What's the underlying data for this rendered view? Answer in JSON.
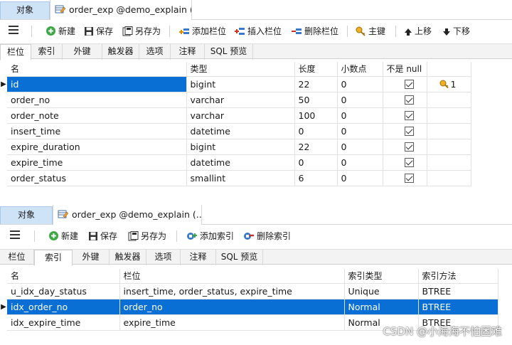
{
  "top": {
    "object_tab": "对象",
    "doc_tab": "order_exp @demo_explain (...",
    "toolbar": {
      "new": "新建",
      "save": "保存",
      "save_as": "另存为",
      "add_column": "添加栏位",
      "insert_column": "插入栏位",
      "delete_column": "删除栏位",
      "primary_key": "主键",
      "move_up": "上移",
      "move_down": "下移"
    },
    "subtabs": [
      "栏位",
      "索引",
      "外键",
      "触发器",
      "选项",
      "注释",
      "SQL 预览"
    ],
    "active_subtab": "栏位",
    "columns_header": [
      "名",
      "类型",
      "长度",
      "小数点",
      "不是 null",
      ""
    ],
    "rows": [
      {
        "name": "id",
        "type": "bigint",
        "length": "22",
        "decimals": "0",
        "not_null": true,
        "key": "1"
      },
      {
        "name": "order_no",
        "type": "varchar",
        "length": "50",
        "decimals": "0",
        "not_null": true,
        "key": ""
      },
      {
        "name": "order_note",
        "type": "varchar",
        "length": "100",
        "decimals": "0",
        "not_null": true,
        "key": ""
      },
      {
        "name": "insert_time",
        "type": "datetime",
        "length": "0",
        "decimals": "0",
        "not_null": true,
        "key": ""
      },
      {
        "name": "expire_duration",
        "type": "bigint",
        "length": "22",
        "decimals": "0",
        "not_null": true,
        "key": ""
      },
      {
        "name": "expire_time",
        "type": "datetime",
        "length": "0",
        "decimals": "0",
        "not_null": true,
        "key": ""
      },
      {
        "name": "order_status",
        "type": "smallint",
        "length": "6",
        "decimals": "0",
        "not_null": true,
        "key": ""
      }
    ]
  },
  "bottom": {
    "object_tab": "对象",
    "doc_tab": "order_exp @demo_explain (...",
    "toolbar": {
      "new": "新建",
      "save": "保存",
      "save_as": "另存为",
      "add_index": "添加索引",
      "delete_index": "删除索引"
    },
    "subtabs": [
      "栏位",
      "索引",
      "外键",
      "触发器",
      "选项",
      "注释",
      "SQL 预览"
    ],
    "active_subtab": "索引",
    "index_header": [
      "名",
      "栏位",
      "索引类型",
      "索引方法"
    ],
    "indexes": [
      {
        "name": "u_idx_day_status",
        "fields": "insert_time, order_status, expire_time",
        "type": "Unique",
        "method": "BTREE"
      },
      {
        "name": "idx_order_no",
        "fields": "order_no",
        "type": "Normal",
        "method": "BTREE"
      },
      {
        "name": "idx_expire_time",
        "fields": "expire_time",
        "type": "Normal",
        "method": "BTREE"
      }
    ]
  },
  "watermark": "CSDN @小海海不怕困难",
  "colors": {
    "selection": "#0a6fd4",
    "object_tab": "#cfe3f7"
  }
}
